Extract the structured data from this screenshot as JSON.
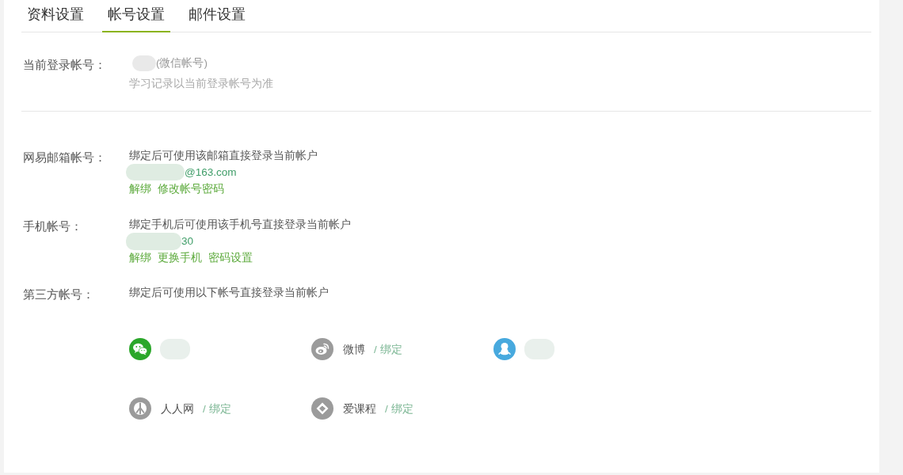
{
  "tabs": [
    {
      "label": "资料设置",
      "selected": false
    },
    {
      "label": "帐号设置",
      "selected": true
    },
    {
      "label": "邮件设置",
      "selected": false
    }
  ],
  "current_account": {
    "label": "当前登录帐号：",
    "account_type": "(微信帐号)",
    "note": "学习记录以当前登录帐号为准"
  },
  "bindings": [
    {
      "label": "网易邮箱帐号：",
      "description": "绑定后可使用该邮箱直接登录当前帐户",
      "value": "@163.com",
      "actions": [
        "解绑",
        "修改帐号密码"
      ]
    },
    {
      "label": "手机帐号：",
      "description": "绑定手机后可使用该手机号直接登录当前帐户",
      "value": "30",
      "actions": [
        "解绑",
        "更换手机",
        "密码设置"
      ]
    }
  ],
  "third_party": {
    "label": "第三方帐号：",
    "description": "绑定后可使用以下帐号直接登录当前帐户",
    "accounts": [
      {
        "kind": "chat",
        "color": "#2ba72a",
        "bound": true
      },
      {
        "kind": "swirl",
        "color": "#9b9b9b",
        "bound": false,
        "name": "微博",
        "action": "/ 绑定"
      },
      {
        "kind": "penguin",
        "color": "#47a9de",
        "bound": true
      },
      {
        "kind": "trident",
        "color": "#9b9b9b",
        "bound": false,
        "name": "人人网",
        "action": "/ 绑定"
      },
      {
        "kind": "diamond",
        "color": "#9b9b9b",
        "bound": false,
        "name": "爱课程",
        "action": "/ 绑定"
      }
    ]
  }
}
